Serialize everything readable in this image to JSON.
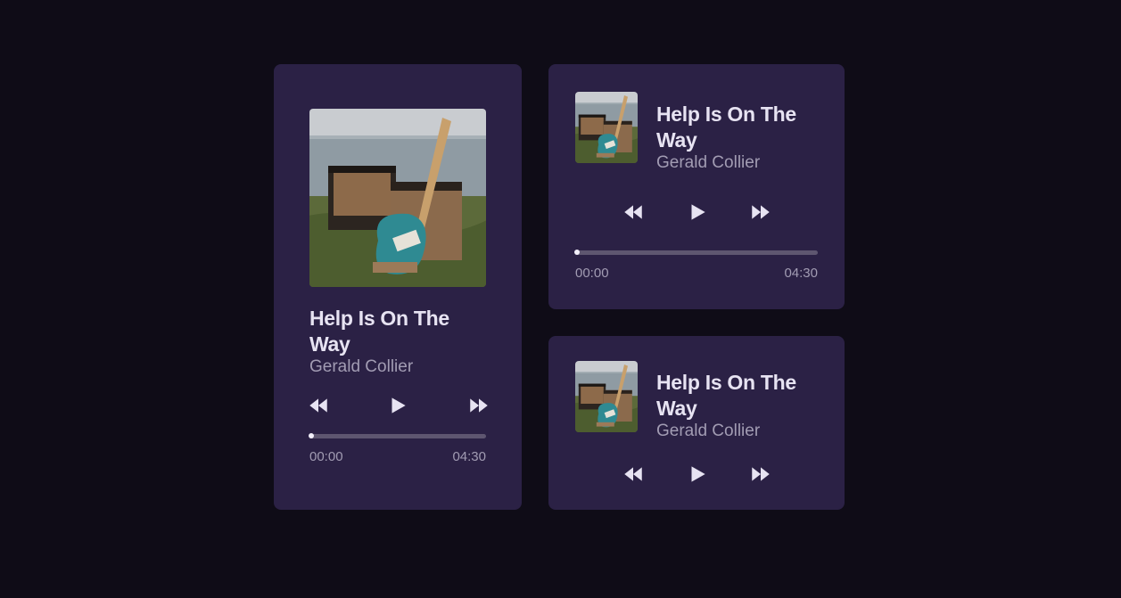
{
  "colors": {
    "background": "#0f0c17",
    "card": "#2b2145",
    "title": "#e7e3f2",
    "muted": "#a29cb3",
    "track": "#5e5670"
  },
  "players": [
    {
      "layout": "large",
      "artwork": "guitar-amplifier-album-art",
      "title": "Help Is On The Way",
      "artist": "Gerald Collier",
      "controls": [
        "rewind-icon",
        "play-icon",
        "fast-forward-icon"
      ],
      "progress": 0,
      "time_current": "00:00",
      "time_total": "04:30"
    },
    {
      "layout": "compact",
      "artwork": "guitar-amplifier-album-art",
      "title": "Help Is On The Way",
      "artist": "Gerald Collier",
      "controls": [
        "rewind-icon",
        "play-icon",
        "fast-forward-icon"
      ],
      "progress": 0,
      "time_current": "00:00",
      "time_total": "04:30"
    },
    {
      "layout": "mini",
      "artwork": "guitar-amplifier-album-art",
      "title": "Help Is On The Way",
      "artist": "Gerald Collier",
      "controls": [
        "rewind-icon",
        "play-icon",
        "fast-forward-icon"
      ]
    }
  ]
}
